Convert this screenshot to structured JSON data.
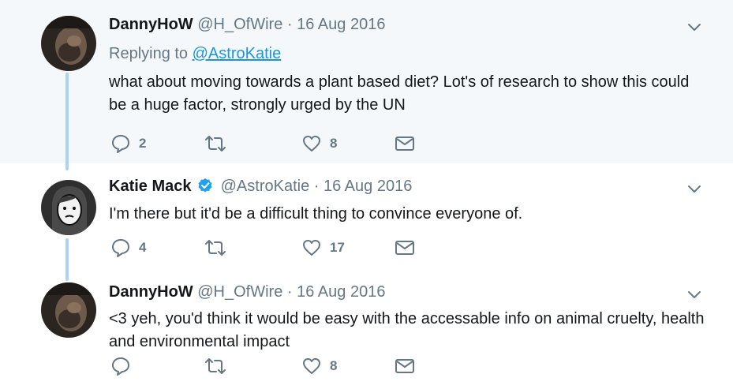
{
  "tweets": [
    {
      "display_name": "DannyHoW",
      "handle": "@H_OfWire",
      "date": "16 Aug 2016",
      "replying_prefix": "Replying to ",
      "replying_to": "@AstroKatie",
      "text": "what about moving towards a plant based diet? Lot's of research to show this could be a huge factor, strongly urged by the UN",
      "reply_count": "2",
      "retweet_count": "",
      "like_count": "8"
    },
    {
      "display_name": "Katie Mack",
      "verified": true,
      "handle": "@AstroKatie",
      "date": "16 Aug 2016",
      "text": "I'm there but it'd be a difficult thing to convince everyone of.",
      "reply_count": "4",
      "retweet_count": "",
      "like_count": "17"
    },
    {
      "display_name": "DannyHoW",
      "handle": "@H_OfWire",
      "date": "16 Aug 2016",
      "text": "<3 yeh, you'd think it would be easy with the accessable info on animal cruelty, health and environmental impact",
      "reply_count": "",
      "retweet_count": "",
      "like_count": "8"
    }
  ],
  "separator": " · ",
  "icons": {
    "reply": "speech-bubble-icon",
    "retweet": "retweet-arrows-icon",
    "like": "heart-outline-icon",
    "dm": "envelope-icon",
    "more": "chevron-down-icon",
    "verified": "verified-badge-icon"
  },
  "colors": {
    "link": "#1b95e0",
    "muted": "#657786",
    "thread_line": "#a9d4f5",
    "highlight_bg": "#f5f8fa",
    "verified": "#1da1f2"
  }
}
